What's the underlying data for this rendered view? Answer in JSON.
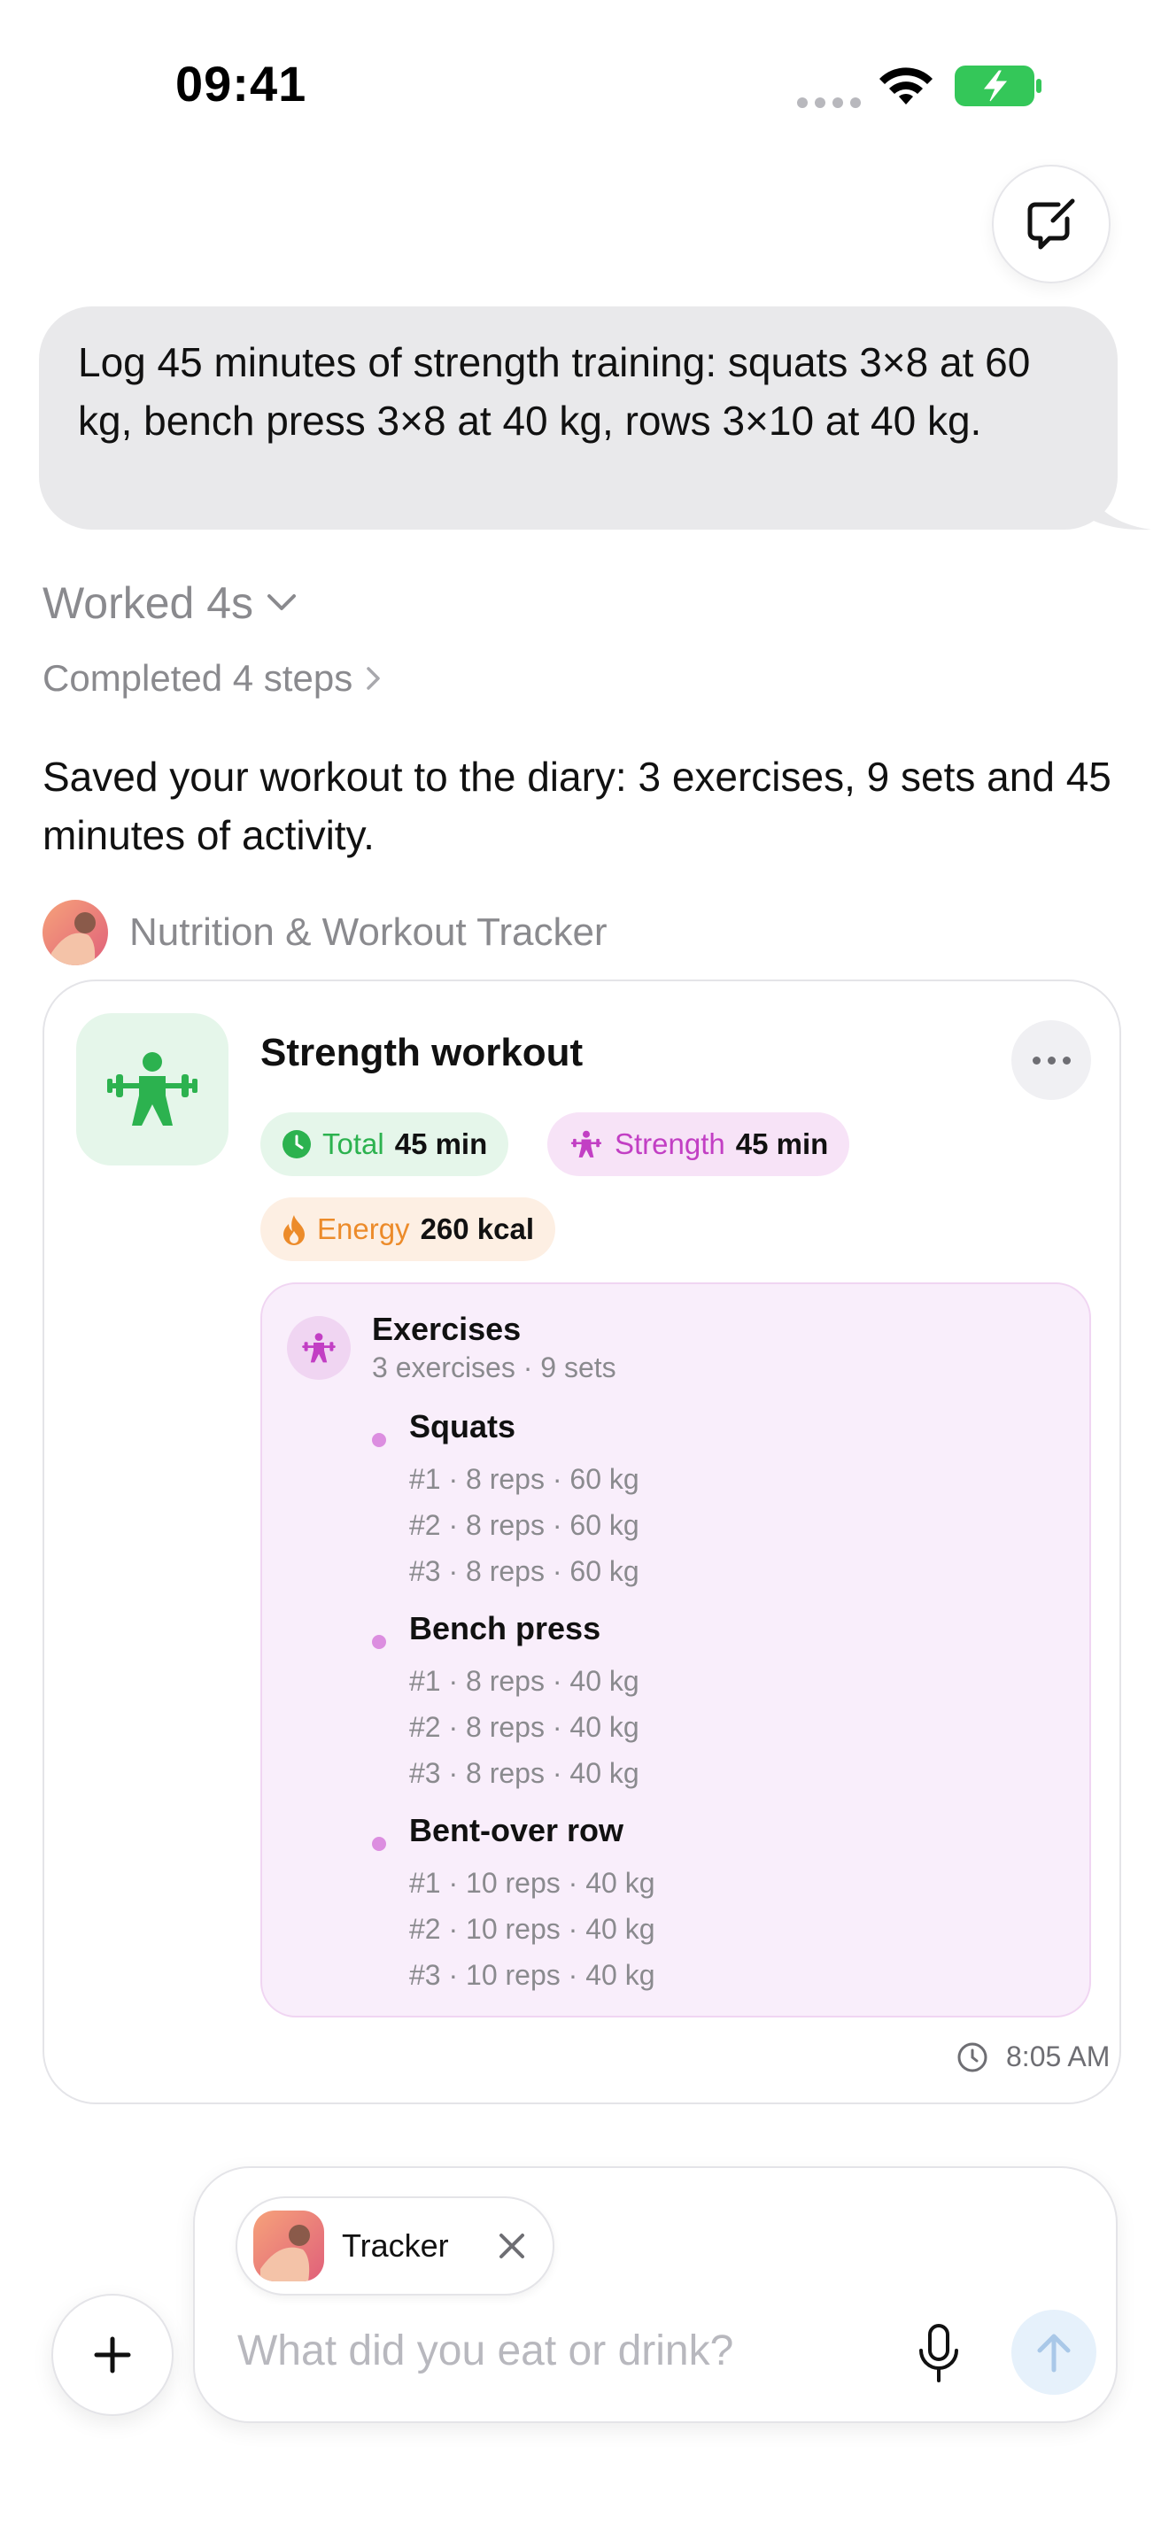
{
  "status_bar": {
    "time": "09:41"
  },
  "user_message": "Log 45 minutes of strength training: squats 3×8 at 60 kg, bench press 3×8 at 40 kg, rows 3×10 at 40 kg.",
  "worked_label": "Worked 4s",
  "steps_label": "Completed 4 steps",
  "assistant_message": "Saved your workout to the diary: 3 exercises, 9 sets and 45 minutes of activity.",
  "app_name": "Nutrition & Workout Tracker",
  "card": {
    "title": "Strength workout",
    "chips": {
      "total_label": "Total",
      "total_value": "45 min",
      "strength_label": "Strength",
      "strength_value": "45 min",
      "energy_label": "Energy",
      "energy_value": "260 kcal"
    },
    "exercises_title": "Exercises",
    "exercises_summary": "3 exercises · 9 sets",
    "exercises": [
      {
        "name": "Squats",
        "sets": [
          "#1 · 8 reps · 60 kg",
          "#2 · 8 reps · 60 kg",
          "#3 · 8 reps · 60 kg"
        ]
      },
      {
        "name": "Bench press",
        "sets": [
          "#1 · 8 reps · 40 kg",
          "#2 · 8 reps · 40 kg",
          "#3 · 8 reps · 40 kg"
        ]
      },
      {
        "name": "Bent-over row",
        "sets": [
          "#1 · 10 reps · 40 kg",
          "#2 · 10 reps · 40 kg",
          "#3 · 10 reps · 40 kg"
        ]
      }
    ],
    "time": "8:05 AM"
  },
  "composer": {
    "tracker_label": "Tracker",
    "placeholder": "What did you eat or drink?"
  },
  "colors": {
    "green_accent": "#2cb24f",
    "magenta_accent": "#c23fc4",
    "orange_accent": "#ec8b2a",
    "battery_green": "#34c759"
  }
}
